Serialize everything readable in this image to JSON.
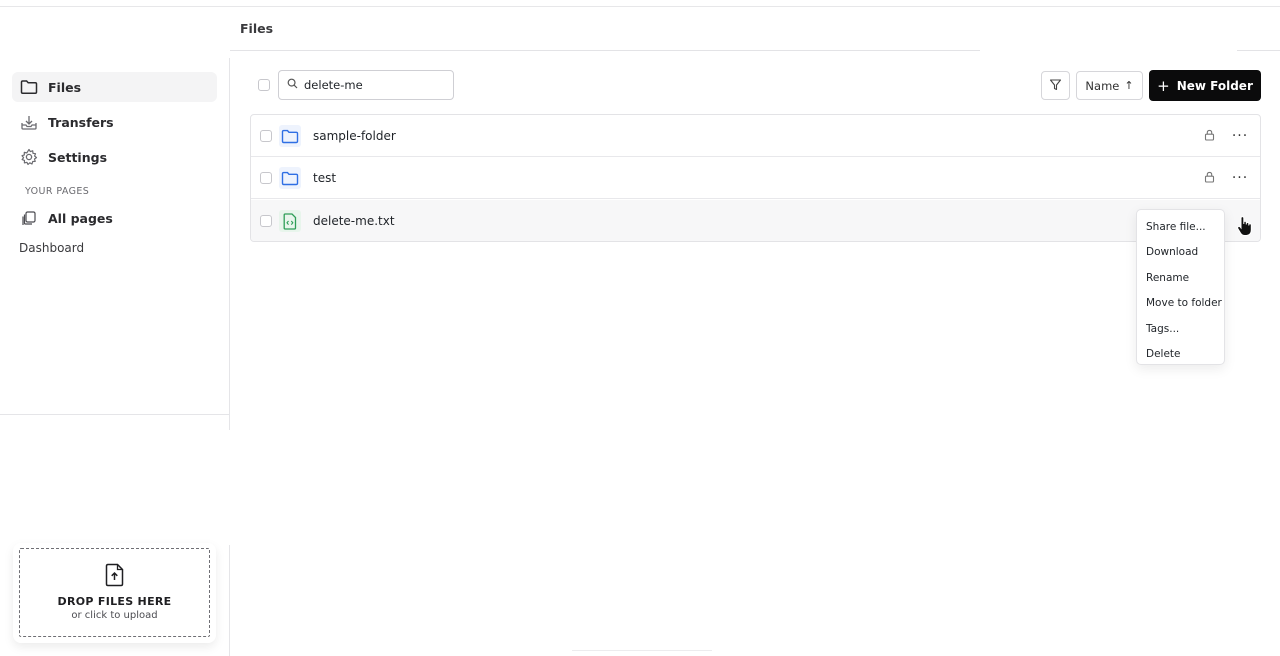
{
  "header": {
    "title": "Files"
  },
  "sidebar": {
    "items": [
      {
        "label": "Files",
        "icon": "folder-icon",
        "active": true
      },
      {
        "label": "Transfers",
        "icon": "download-tray-icon",
        "active": false
      },
      {
        "label": "Settings",
        "icon": "gear-icon",
        "active": false
      }
    ],
    "section_label": "YOUR PAGES",
    "pages_item": {
      "label": "All pages",
      "icon": "pages-icon"
    },
    "dashboard_label": "Dashboard"
  },
  "dropzone": {
    "title": "DROP FILES HERE",
    "subtitle": "or click to upload",
    "icon": "file-upload-icon"
  },
  "toolbar": {
    "search_value": "delete-me",
    "filter_icon": "filter-icon",
    "sort_label": "Name",
    "sort_direction_glyph": "↑",
    "new_folder_label": "New Folder"
  },
  "files": [
    {
      "name": "sample-folder",
      "type": "folder",
      "locked": true
    },
    {
      "name": "test",
      "type": "folder",
      "locked": true
    },
    {
      "name": "delete-me.txt",
      "type": "document",
      "locked": false
    }
  ],
  "context_menu": {
    "items": [
      "Share file...",
      "Download",
      "Rename",
      "Move to folder",
      "Tags...",
      "Delete"
    ]
  },
  "colors": {
    "accent": "#0b0b0c",
    "folder_icon": "#2f6fe4",
    "doc_icon": "#2e9e57"
  }
}
